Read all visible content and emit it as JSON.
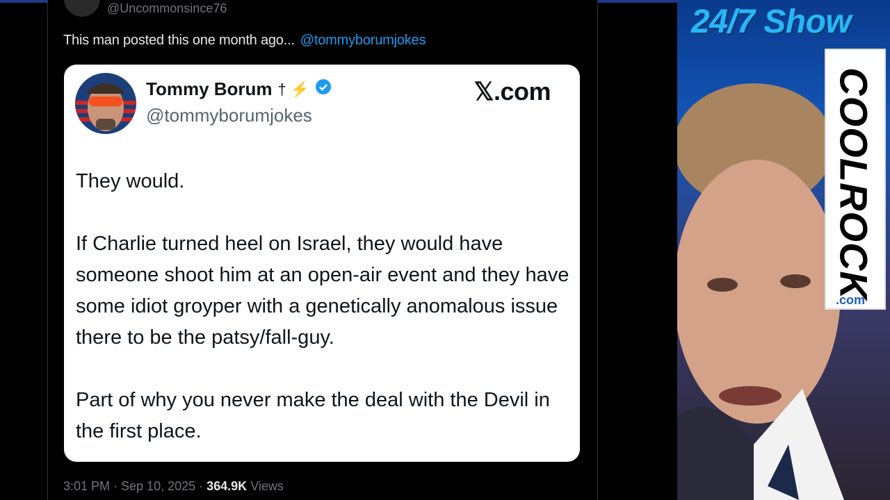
{
  "tweet": {
    "handle": "@Uncommonsince76",
    "text": "This man posted this one month ago...",
    "mention": "@tommyborumjokes"
  },
  "quote": {
    "name": "Tommy Borum",
    "name_symbols": "† ⚡",
    "handle": "@tommyborumjokes",
    "brand": "𝕏.com",
    "body": [
      "They would.",
      "If Charlie turned heel on Israel, they would have someone shoot him at an open-air event and they have some idiot groyper with a genetically anomalous issue there to be the patsy/fall-guy.",
      "Part of why you never make the deal with the Devil in the first place."
    ]
  },
  "meta": {
    "time": "3:01 PM · Sep 10, 2025 ·",
    "views_count": "364.9K",
    "views_label": "Views"
  },
  "overlay": {
    "show_title": "24/7 Show",
    "logo_text": "COOLROCK",
    "logo_suffix": ".com"
  },
  "colors": {
    "link": "#1d9bf0",
    "verified": "#1d9bf0",
    "show_title": "#29b6f6"
  }
}
